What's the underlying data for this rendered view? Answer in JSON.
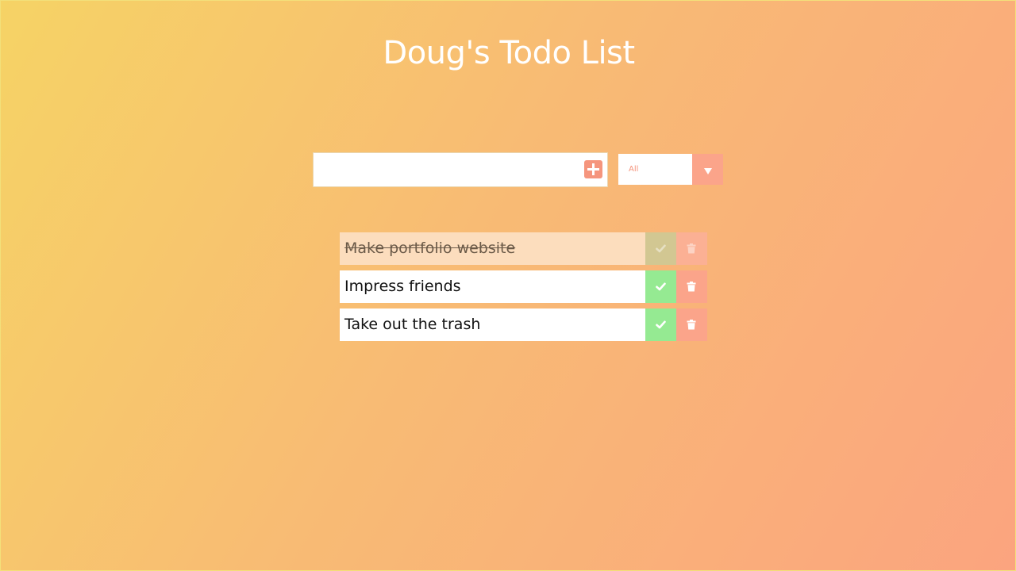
{
  "header": {
    "title": "Doug's Todo List"
  },
  "form": {
    "input_value": "",
    "input_placeholder": "",
    "add_icon": "plus-square-icon"
  },
  "filter": {
    "selected": "All",
    "arrow_icon": "caret-down-icon"
  },
  "todos": [
    {
      "text": "Make portfolio website",
      "completed": true
    },
    {
      "text": "Impress friends",
      "completed": false
    },
    {
      "text": "Take out the trash",
      "completed": false
    }
  ],
  "icons": {
    "complete": "check-icon",
    "delete": "trash-icon"
  },
  "colors": {
    "gradient_start": "#f6d365",
    "gradient_end": "#fda085",
    "accent": "#f5957d",
    "check": "#95ea92",
    "trash": "#fba48a",
    "completed_row": "#fcddbd"
  }
}
